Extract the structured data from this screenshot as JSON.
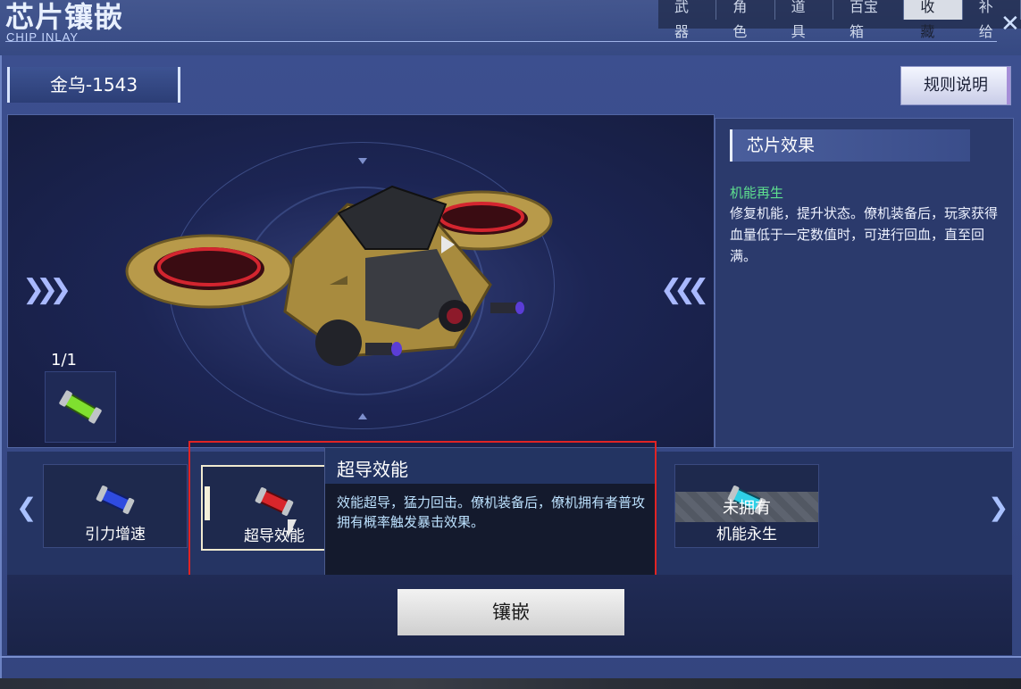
{
  "header": {
    "title": "芯片镶嵌",
    "subtitle": "CHIP INLAY",
    "tabs": [
      "武器",
      "角色",
      "道具",
      "百宝箱",
      "收藏",
      "补给"
    ],
    "active_tab": "收藏",
    "close_icon": "close-icon"
  },
  "unit": {
    "name": "金乌-1543"
  },
  "rules_button": "规则说明",
  "slots": {
    "count": "1/1",
    "icon": "green-chip-icon"
  },
  "effect_panel": {
    "heading": "芯片效果",
    "effect_name": "机能再生",
    "effect_desc": "修复机能，提升状态。僚机装备后，玩家获得血量低于一定数值时，可进行回血，直至回满。"
  },
  "chips": [
    {
      "label": "引力增速",
      "icon": "blue-chip-icon",
      "owned": true,
      "selected": false
    },
    {
      "label": "超导效能",
      "icon": "red-chip-icon",
      "owned": true,
      "selected": true
    },
    {
      "label": "机能永生",
      "icon": "cyan-chip-icon",
      "owned": false,
      "selected": false,
      "locked_text": "未拥有"
    }
  ],
  "tooltip": {
    "title": "超导效能",
    "desc": "效能超导，猛力回击。僚机装备后，僚机拥有者普攻拥有概率触发暴击效果。"
  },
  "inlay_button": "镶嵌",
  "colors": {
    "effect_name": "#5ee08f",
    "highlight": "#e02424",
    "accent": "#a9b9ff"
  }
}
